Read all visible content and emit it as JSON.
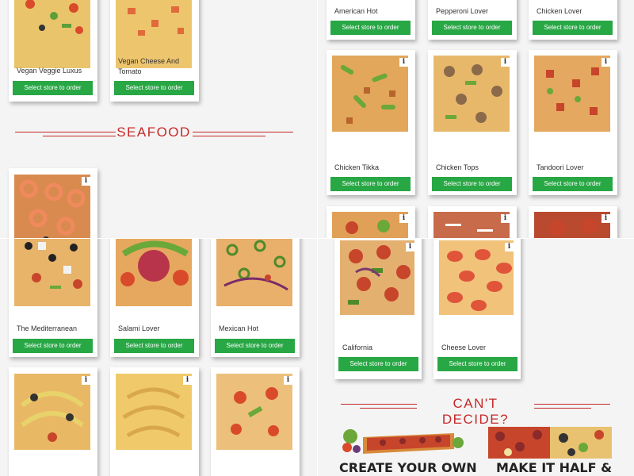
{
  "order_button_label": "Select store to order",
  "info_icon_glyph": "i",
  "section_seafood": "SEAFOOD",
  "section_cant_decide": "CAN'T DECIDE?",
  "accent_color": "#c62828",
  "button_color": "#28a745",
  "top_left": {
    "cards": [
      {
        "name": "Vegan Veggie Luxus"
      },
      {
        "name": "Vegan Cheese And Tomato"
      },
      {
        "name": ""
      }
    ]
  },
  "top_right": {
    "row1": [
      {
        "name": "American Hot"
      },
      {
        "name": "Pepperoni Lover"
      },
      {
        "name": "Chicken Lover"
      }
    ],
    "row2": [
      {
        "name": "Chicken Tikka"
      },
      {
        "name": "Chicken Tops"
      },
      {
        "name": "Tandoori Lover"
      }
    ]
  },
  "bottom_left": {
    "row1": [
      {
        "name": "The Mediterranean"
      },
      {
        "name": "Salami Lover"
      },
      {
        "name": "Mexican Hot"
      }
    ]
  },
  "bottom_right": {
    "cards": [
      {
        "name": "California"
      },
      {
        "name": "Cheese Lover"
      }
    ],
    "promo_create": "CREATE YOUR OWN",
    "promo_half": "MAKE IT HALF &"
  }
}
